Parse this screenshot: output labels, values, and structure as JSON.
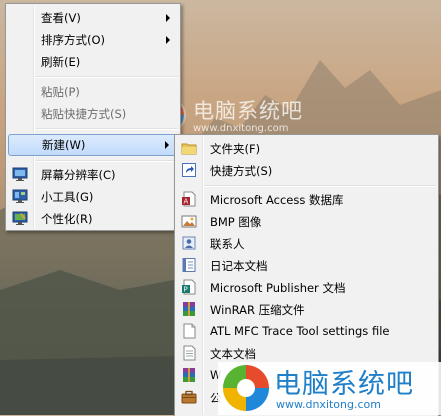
{
  "context_menu": {
    "items": [
      {
        "label": "查看(V)"
      },
      {
        "label": "排序方式(O)"
      },
      {
        "label": "刷新(E)"
      },
      {
        "label": "粘贴(P)"
      },
      {
        "label": "粘贴快捷方式(S)"
      },
      {
        "label": "新建(W)"
      },
      {
        "label": "屏幕分辨率(C)",
        "icon": "screen-resolution-icon"
      },
      {
        "label": "小工具(G)",
        "icon": "gadgets-icon"
      },
      {
        "label": "个性化(R)",
        "icon": "personalize-icon"
      }
    ]
  },
  "new_submenu": {
    "items": [
      {
        "label": "文件夹(F)",
        "icon": "folder-icon"
      },
      {
        "label": "快捷方式(S)",
        "icon": "shortcut-icon"
      },
      {
        "label": "Microsoft Access 数据库",
        "icon": "access-icon"
      },
      {
        "label": "BMP 图像",
        "icon": "bmp-image-icon"
      },
      {
        "label": "联系人",
        "icon": "contact-icon"
      },
      {
        "label": "日记本文档",
        "icon": "journal-icon"
      },
      {
        "label": "Microsoft Publisher 文档",
        "icon": "publisher-icon"
      },
      {
        "label": "WinRAR 压缩文件",
        "icon": "winrar-icon"
      },
      {
        "label": "ATL MFC Trace Tool settings file",
        "icon": "settings-file-icon"
      },
      {
        "label": "文本文档",
        "icon": "text-document-icon"
      },
      {
        "label": "W",
        "icon": "winrar-zip-icon"
      },
      {
        "label": "公",
        "icon": "briefcase-icon"
      }
    ]
  },
  "watermark": {
    "title": "电脑系统吧",
    "url": "www.dnxitong.com"
  },
  "colors": {
    "menu_bg": "#f1f1f1",
    "highlight": "#c1dbfc",
    "watermark_blue": "#1f7fc8"
  }
}
